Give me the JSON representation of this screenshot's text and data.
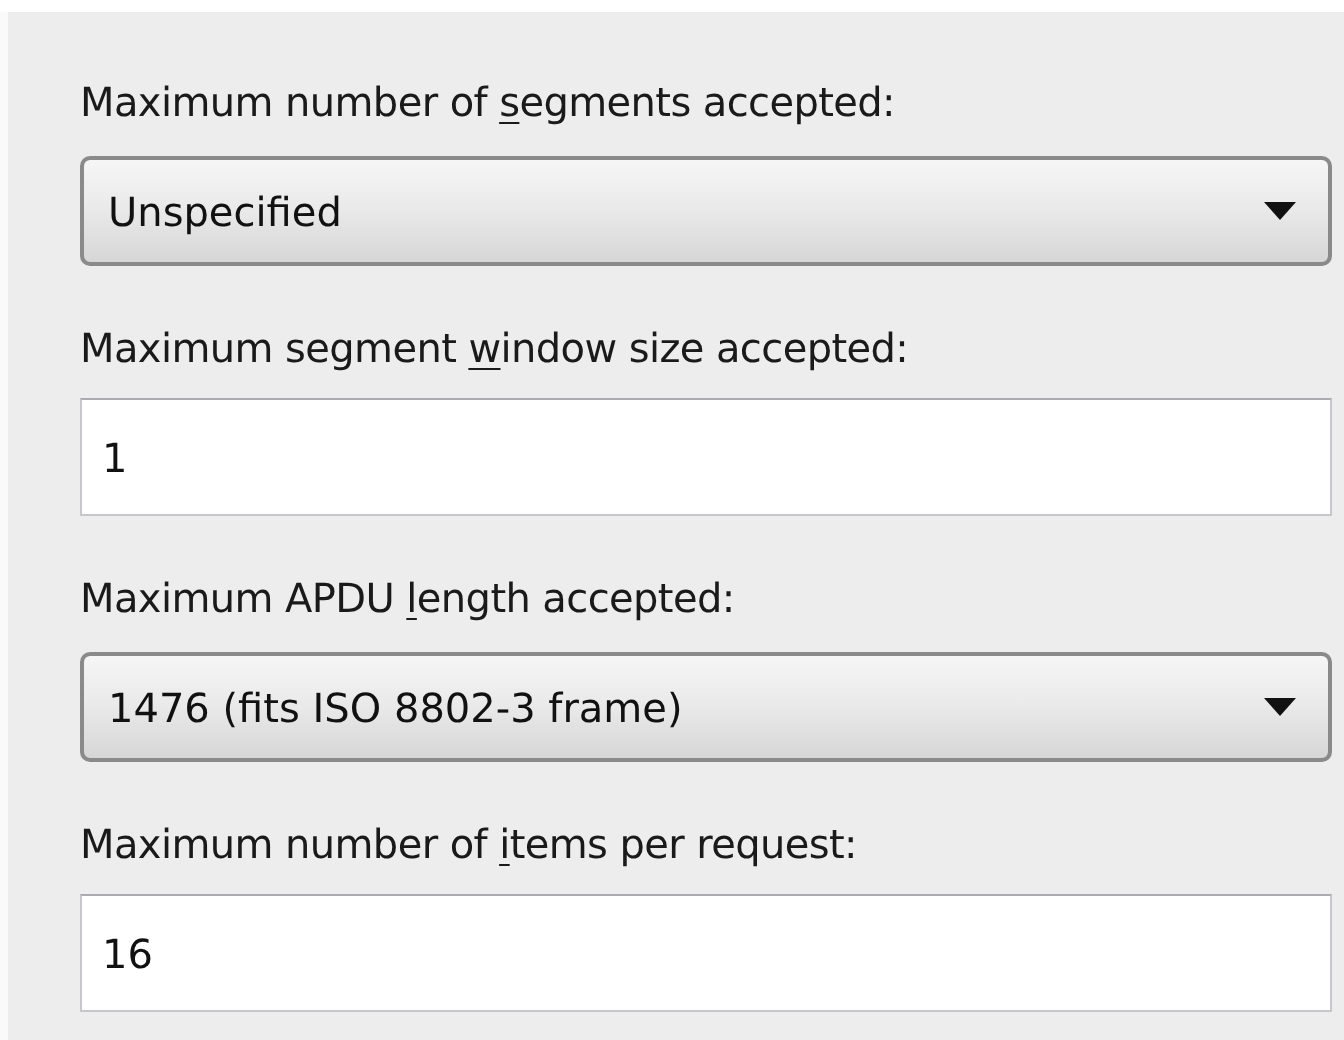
{
  "fields": [
    {
      "kind": "dropdown",
      "label_before": "Maximum number of ",
      "access_key": "s",
      "label_after": "egments accepted:",
      "value": "Unspecified"
    },
    {
      "kind": "textbox",
      "label_before": "Maximum segment ",
      "access_key": "w",
      "label_after": "indow size accepted:",
      "value": "1"
    },
    {
      "kind": "dropdown",
      "label_before": "Maximum APDU ",
      "access_key": "l",
      "label_after": "ength accepted:",
      "value": "1476 (fits ISO 8802-3 frame)"
    },
    {
      "kind": "textbox",
      "label_before": "Maximum number of ",
      "access_key": "i",
      "label_after": "tems per request:",
      "value": "16"
    }
  ]
}
